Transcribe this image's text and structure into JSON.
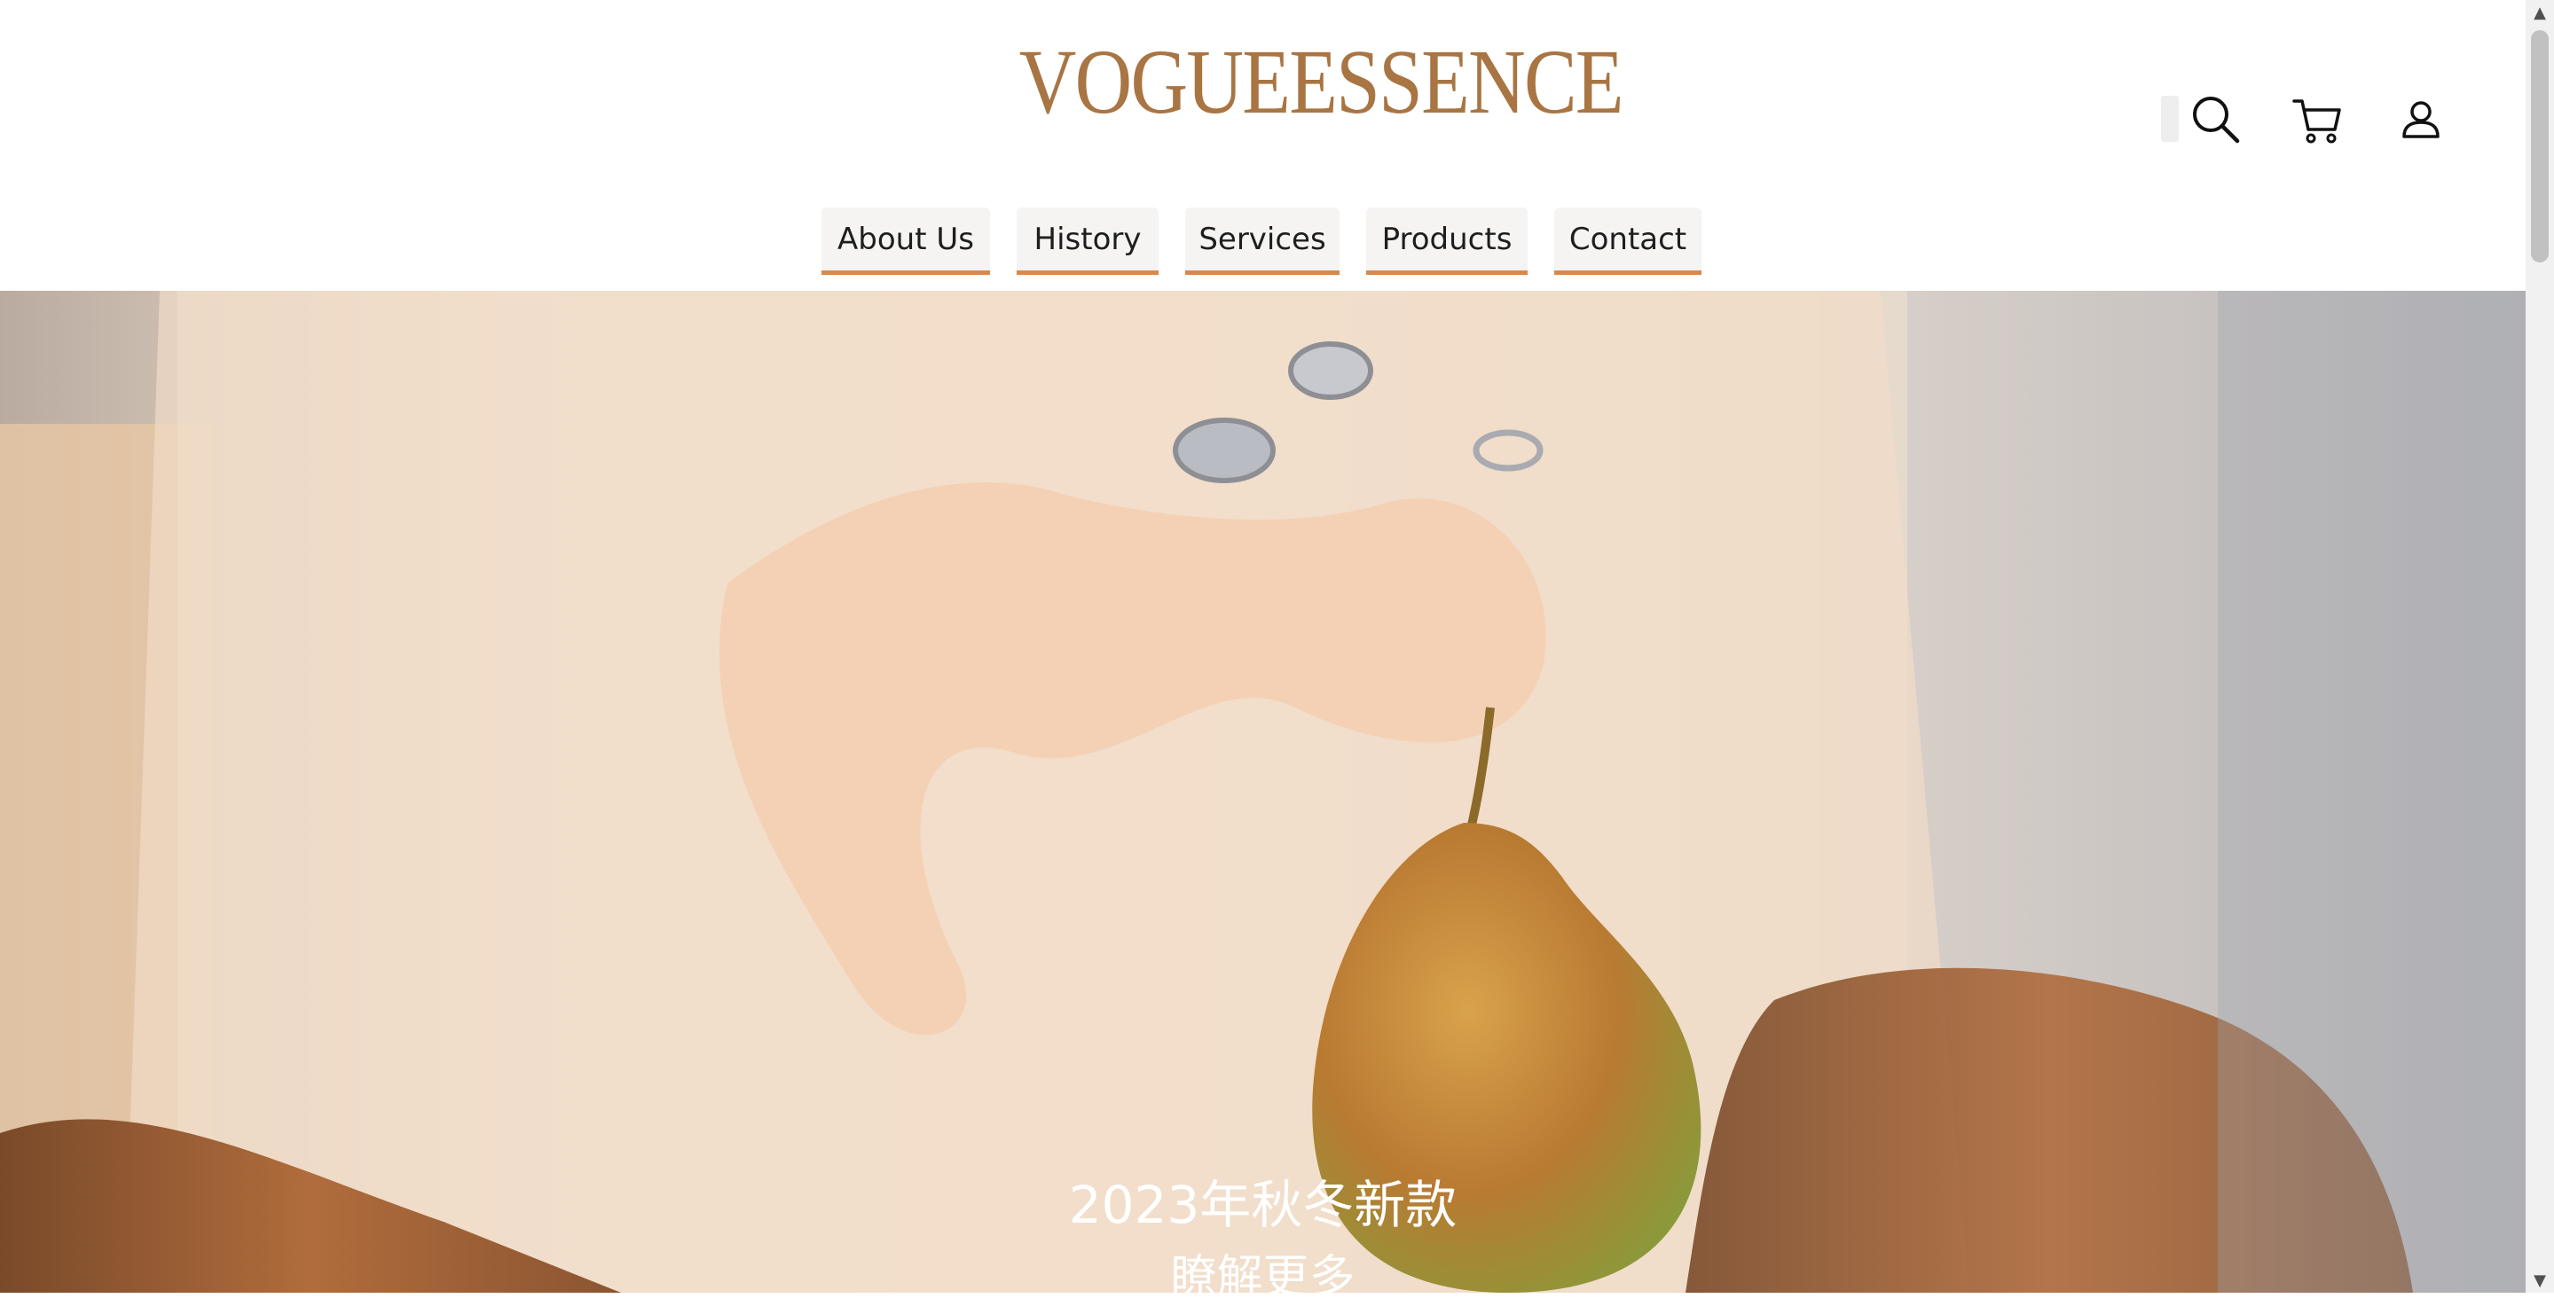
{
  "brand": {
    "logo_text": "VOGUEESSENCE",
    "accent_color": "#a87543"
  },
  "header": {
    "icons": [
      "search-icon",
      "cart-icon",
      "user-icon"
    ]
  },
  "nav": {
    "items": [
      {
        "label": "About Us"
      },
      {
        "label": "History"
      },
      {
        "label": "Services"
      },
      {
        "label": "Products"
      },
      {
        "label": "Contact"
      }
    ],
    "underline_color": "#d9884a"
  },
  "hero": {
    "title": "2023年秋冬新款",
    "link_label": "瞭解更多",
    "image_description_icon": "hero-photo"
  },
  "scrollbar": {
    "up_arrow": "▲",
    "down_arrow": "▼"
  }
}
